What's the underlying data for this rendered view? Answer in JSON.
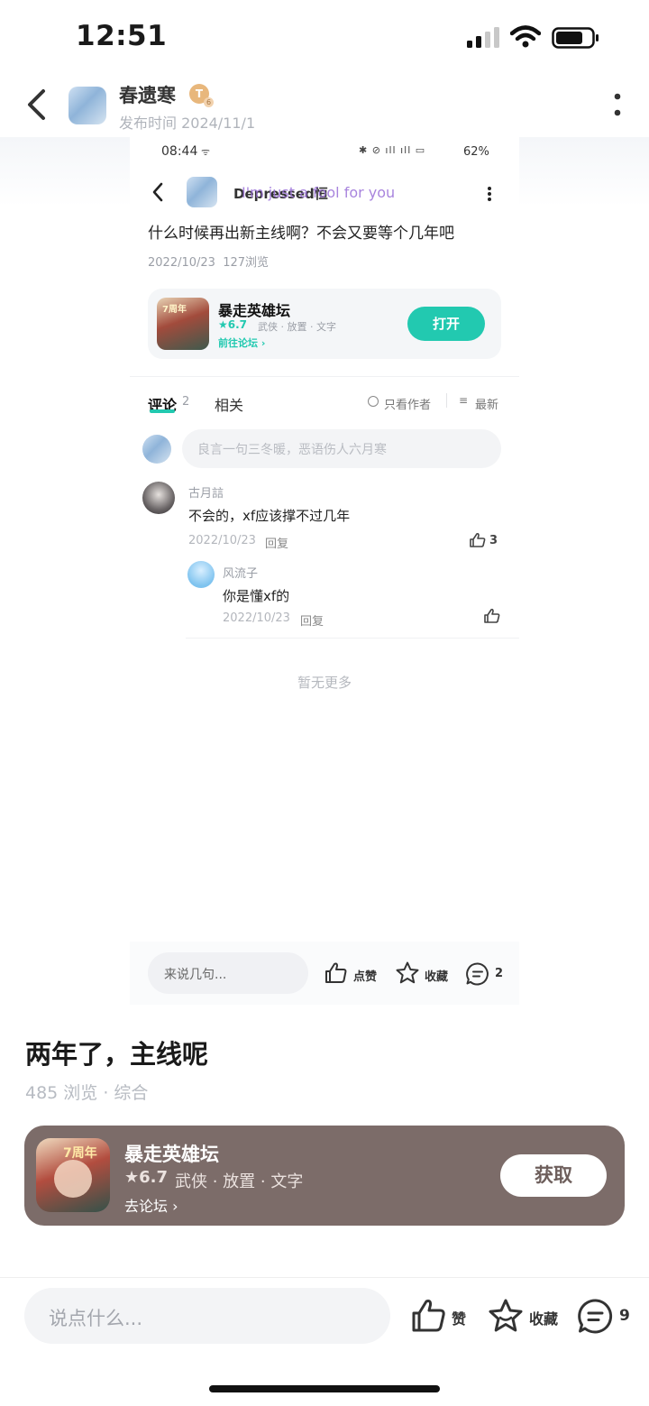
{
  "status_bar": {
    "time": "12:51"
  },
  "header": {
    "author": "春遗寒",
    "badge": "T",
    "badge_sub": "6",
    "publish_time": "发布时间 2024/11/1"
  },
  "screenshot": {
    "status": {
      "time": "08:44",
      "battery": "62%"
    },
    "nav": {
      "user_name": "Depressed恒",
      "overlay_text": "I'm just a fool for you"
    },
    "post_text": "什么时候再出新主线啊？不会又要等个几年吧",
    "post_meta": "2022/10/23  127浏览",
    "game": {
      "name": "暴走英雄坛",
      "rating": "★6.7",
      "tags": "武侠 · 放置 · 文字",
      "forum_link": "前往论坛 ›",
      "open_label": "打开",
      "icon_text": "7周年"
    },
    "tabs": {
      "comments": "评论",
      "comments_count": "2",
      "related": "相关"
    },
    "filters": {
      "author_only": "只看作者",
      "latest": "最新"
    },
    "comment_input_placeholder": "良言一句三冬暖，恶语伤人六月寒",
    "comments": [
      {
        "user": "古月誩",
        "text": "不会的，xf应该撑不过几年",
        "date": "2022/10/23",
        "reply": "回复",
        "likes": "3"
      }
    ],
    "replies": [
      {
        "user": "风流子",
        "text": "你是懂xf的",
        "date": "2022/10/23",
        "reply": "回复"
      }
    ],
    "no_more": "暂无更多",
    "bottom": {
      "placeholder": "来说几句...",
      "like": "点赞",
      "favorite": "收藏",
      "comment_count": "2"
    }
  },
  "post": {
    "title": "两年了，主线呢",
    "meta": "485 浏览 · 综合"
  },
  "game_card": {
    "name": "暴走英雄坛",
    "rating": "★6.7",
    "tags": "武侠 · 放置 · 文字",
    "forum_link": "去论坛 ›",
    "get_label": "获取",
    "icon_text": "7周年",
    "bg_color": "#7c6c69"
  },
  "bottom_bar": {
    "placeholder": "说点什么...",
    "like": "赞",
    "favorite": "收藏",
    "comment_count": "9"
  },
  "colors": {
    "accent": "#22c9b0",
    "badge": "#e8b77c"
  }
}
